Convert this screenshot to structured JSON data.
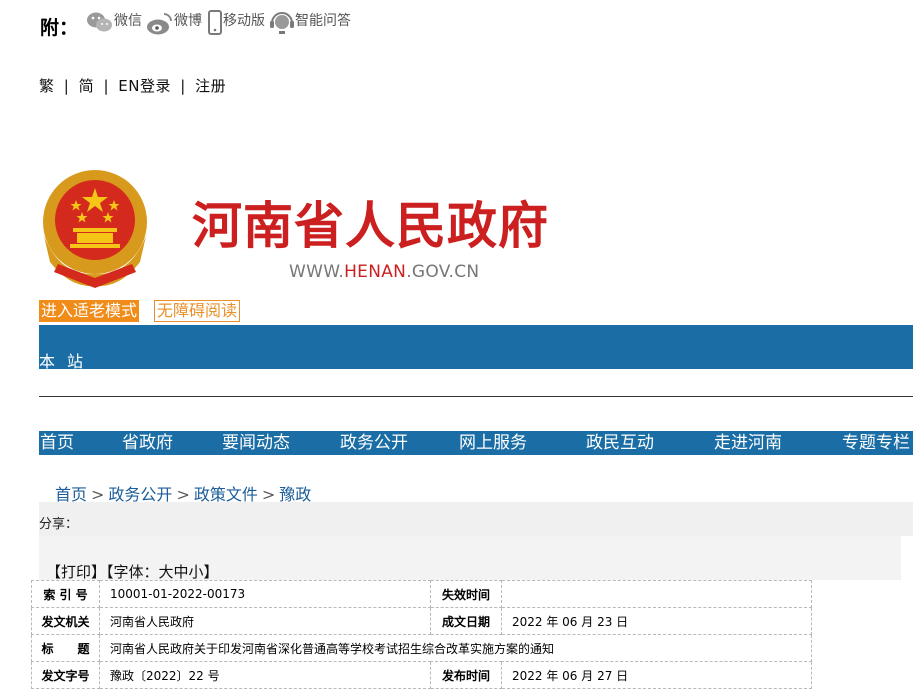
{
  "share": {
    "label": "附：",
    "items": [
      {
        "label": "微信",
        "icon": "wechat-icon"
      },
      {
        "label": "微博",
        "icon": "weibo-icon"
      },
      {
        "label": "移动版",
        "icon": "mobile-icon"
      },
      {
        "label": "智能问答",
        "icon": "assistant-icon"
      }
    ]
  },
  "lang_bar": {
    "traditional": "繁",
    "simplified": "简",
    "english": "EN",
    "login": "登录",
    "register": "注册",
    "separator": "|"
  },
  "logo": {
    "site_name": "河南省人民政府",
    "domain_prefix": "WWW.",
    "domain_main": "HENAN",
    "domain_suffix": ".GOV.CN"
  },
  "accessibility": {
    "elder_mode": "进入适老模式",
    "barrier_free": "无障碍阅读"
  },
  "site_search": {
    "label": "本站"
  },
  "nav": {
    "items": [
      "首页",
      "省政府",
      "要闻动态",
      "政务公开",
      "网上服务",
      "政民互动",
      "走进河南",
      "专题专栏"
    ]
  },
  "breadcrumb": {
    "items": [
      "首页",
      "政务公开",
      "政策文件",
      "豫政"
    ],
    "sep": ">"
  },
  "share_label": "分享：",
  "tools": {
    "print": "【打印】",
    "font": "【字体：大中小】"
  },
  "meta": {
    "index_label": "索 引 号",
    "index_value": "10001-01-2022-00173",
    "expire_label": "失效时间",
    "expire_value": "",
    "issuer_label": "发文机关",
    "issuer_value": "河南省人民政府",
    "created_label": "成文日期",
    "created_value": "2022 年 06 月 23 日",
    "title_label": "标　　题",
    "title_value": "河南省人民政府关于印发河南省深化普通高等学校考试招生综合改革实施方案的通知",
    "docno_label": "发文字号",
    "docno_value": "豫政〔2022〕22 号",
    "published_label": "发布时间",
    "published_value": "2022 年 06 月 27 日"
  },
  "colors": {
    "brand_red": "#cc1f1f",
    "nav_blue": "#1b6ea5",
    "elder_orange": "#f08c1a"
  }
}
